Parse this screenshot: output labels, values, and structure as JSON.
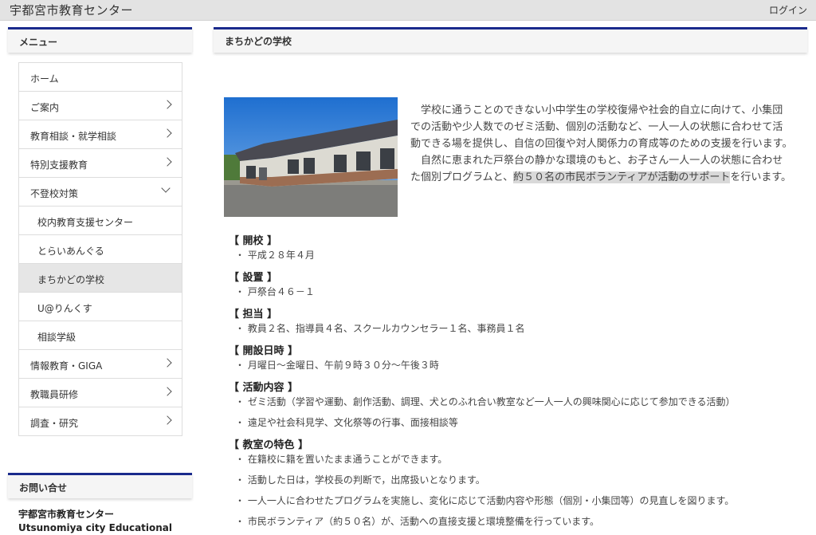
{
  "header": {
    "site_title": "宇都宮市教育センター",
    "login": "ログイン"
  },
  "sidebar": {
    "menu_title": "メニュー",
    "items": [
      {
        "label": "ホーム",
        "chevron": "none",
        "sub": false,
        "active": false
      },
      {
        "label": "ご案内",
        "chevron": "right",
        "sub": false,
        "active": false
      },
      {
        "label": "教育相談・就学相談",
        "chevron": "right",
        "sub": false,
        "active": false
      },
      {
        "label": "特別支援教育",
        "chevron": "right",
        "sub": false,
        "active": false
      },
      {
        "label": "不登校対策",
        "chevron": "down",
        "sub": false,
        "active": false
      },
      {
        "label": "校内教育支援センター",
        "chevron": "none",
        "sub": true,
        "active": false
      },
      {
        "label": "とらいあんぐる",
        "chevron": "none",
        "sub": true,
        "active": false
      },
      {
        "label": "まちかどの学校",
        "chevron": "none",
        "sub": true,
        "active": true
      },
      {
        "label": "U@りんくす",
        "chevron": "none",
        "sub": true,
        "active": false
      },
      {
        "label": "相談学級",
        "chevron": "none",
        "sub": true,
        "active": false
      },
      {
        "label": "情報教育・GIGA",
        "chevron": "right",
        "sub": false,
        "active": false
      },
      {
        "label": "教職員研修",
        "chevron": "right",
        "sub": false,
        "active": false
      },
      {
        "label": "調査・研究",
        "chevron": "right",
        "sub": false,
        "active": false
      }
    ],
    "contact_title": "お問い合せ",
    "contact_name_ja": "宇都宮市教育センター",
    "contact_name_en": "Utsunomiya city Educational"
  },
  "main": {
    "page_title": "まちかどの学校",
    "intro_p1": "学校に通うことのできない小中学生の学校復帰や社会的自立に向けて、小集団での活動や少人数でのゼミ活動、個別の活動など、一人一人の状態に合わせて活動できる場を提供し、自信の回復や対人関係力の育成等のための支援を行います。",
    "intro_p2_a": "自然に恵まれた戸祭台の静かな環境のもと、お子さん一人一人の状態に合わせた個別プログラムと、",
    "intro_p2_highlight": "約５０名の市民ボランティアが活動のサポート",
    "intro_p2_b": "を行います。",
    "sections": [
      {
        "title": "【 開校 】",
        "items": [
          "・ 平成２８年４月"
        ]
      },
      {
        "title": "【 設置 】",
        "items": [
          "・ 戸祭台４６－１"
        ]
      },
      {
        "title": "【 担当 】",
        "items": [
          "・ 教員２名、指導員４名、スクールカウンセラー１名、事務員１名"
        ]
      },
      {
        "title": "【 開設日時 】",
        "items": [
          "・ 月曜日～金曜日、午前９時３０分～午後３時"
        ]
      },
      {
        "title": "【 活動内容 】",
        "items": [
          "・ ゼミ活動（学習や運動、創作活動、調理、犬とのふれ合い教室など一人一人の興味関心に応じて参加できる活動）",
          "・ 遠足や社会科見学、文化祭等の行事、面接相談等"
        ]
      },
      {
        "title": "【 教室の特色 】",
        "items": [
          "・ 在籍校に籍を置いたまま通うことができます。",
          "・ 活動した日は，学校長の判断で，出席扱いとなります。",
          "・ 一人一人に合わせたプログラムを実施し、変化に応じて活動内容や形態（個別・小集団等）の見直しを図ります。",
          "・ 市民ボランティア（約５０名）が、活動への直接支援と環境整備を行っています。"
        ]
      }
    ]
  },
  "colors": {
    "accent": "#1a2a8c",
    "topbar": "#e3e3e3",
    "active_item": "#e6e6e6"
  }
}
